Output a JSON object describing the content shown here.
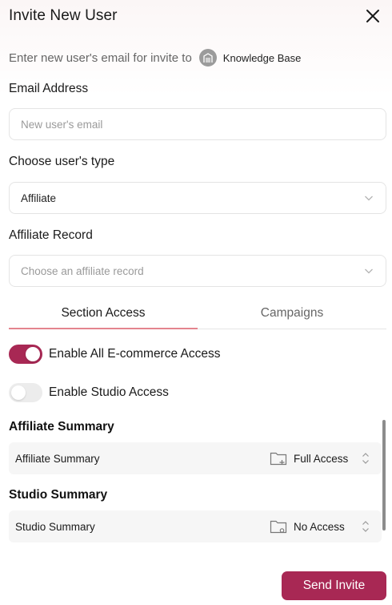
{
  "modal": {
    "title": "Invite New User",
    "subtitle": "Enter new user's email for invite to",
    "workspace_name": "Knowledge Base"
  },
  "email": {
    "label": "Email Address",
    "placeholder": "New user's email",
    "value": ""
  },
  "user_type": {
    "label": "Choose user's type",
    "selected": "Affiliate"
  },
  "affiliate_record": {
    "label": "Affiliate Record",
    "placeholder": "Choose an affiliate record"
  },
  "tabs": [
    {
      "label": "Section Access",
      "active": true
    },
    {
      "label": "Campaigns",
      "active": false
    }
  ],
  "toggles": [
    {
      "label": "Enable All E-commerce Access",
      "on": true
    },
    {
      "label": "Enable Studio Access",
      "on": false
    }
  ],
  "sections": [
    {
      "title": "Affiliate Summary",
      "row_name": "Affiliate Summary",
      "access": "Full Access",
      "icon": "folder-plus-icon"
    },
    {
      "title": "Studio Summary",
      "row_name": "Studio Summary",
      "access": "No Access",
      "icon": "folder-settings-icon"
    }
  ],
  "actions": {
    "send_label": "Send Invite"
  },
  "colors": {
    "accent": "#a82854",
    "tab_underline": "#e4848e"
  }
}
